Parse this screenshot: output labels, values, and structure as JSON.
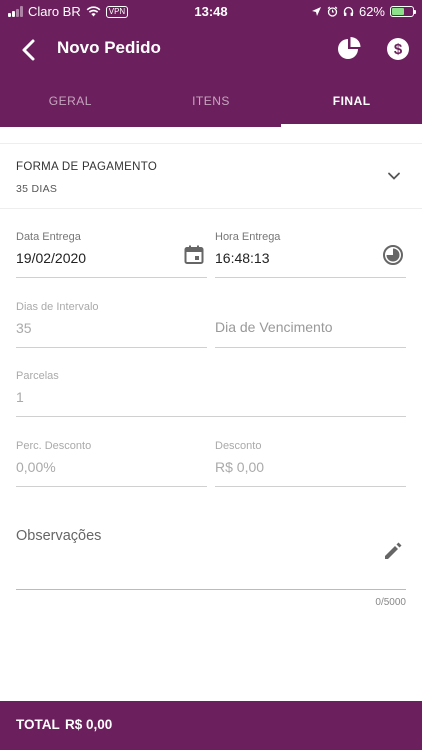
{
  "statusbar": {
    "carrier": "Claro BR",
    "vpn": "VPN",
    "time": "13:48",
    "battery": "62%",
    "battery_level": 0.62
  },
  "toolbar": {
    "title": "Novo Pedido",
    "icons": [
      "back-arrow-icon",
      "pie-chart-icon",
      "dollar-icon"
    ]
  },
  "tabs": [
    {
      "label": "GERAL",
      "active": false
    },
    {
      "label": "ITENS",
      "active": false
    },
    {
      "label": "FINAL",
      "active": true
    }
  ],
  "payment": {
    "label": "FORMA DE PAGAMENTO",
    "value": "35 DIAS"
  },
  "fields": {
    "data_entrega": {
      "label": "Data Entrega",
      "value": "19/02/2020"
    },
    "hora_entrega": {
      "label": "Hora Entrega",
      "value": "16:48:13"
    },
    "dias_intervalo": {
      "label": "Dias de Intervalo",
      "value": "35"
    },
    "dia_vencimento": {
      "placeholder": "Dia de Vencimento"
    },
    "parcelas": {
      "label": "Parcelas",
      "value": "1"
    },
    "perc_desconto": {
      "label": "Perc. Desconto",
      "value": "0,00%"
    },
    "desconto": {
      "label": "Desconto",
      "value": "R$ 0,00"
    },
    "observacoes": {
      "label": "Observações",
      "counter": "0/5000"
    }
  },
  "footer": {
    "total_label": "TOTAL",
    "total_value": "R$ 0,00"
  },
  "colors": {
    "primary": "#6b1f5c",
    "text": "#222222",
    "muted": "#aaaaaa"
  }
}
